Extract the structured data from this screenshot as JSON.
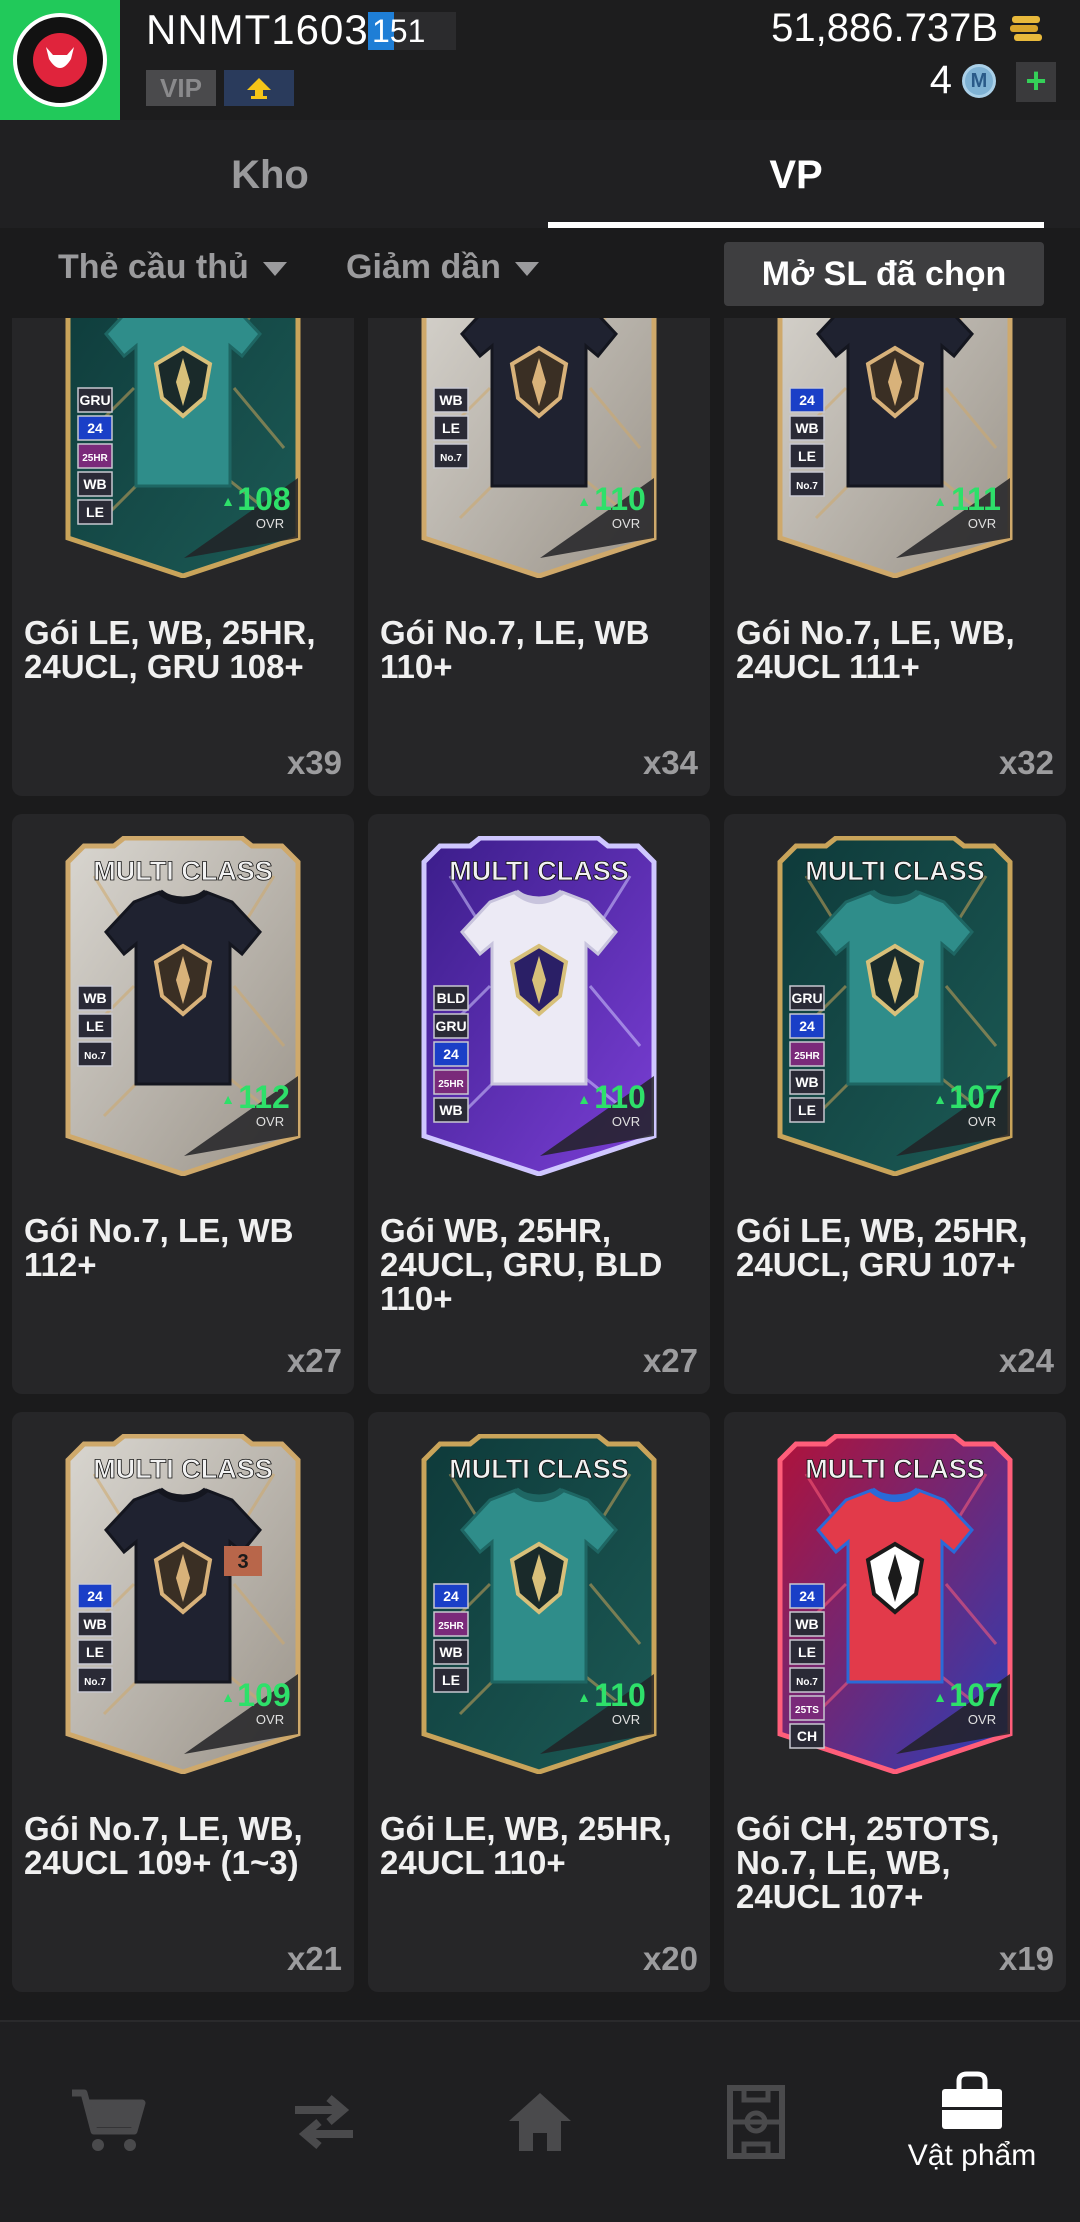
{
  "header": {
    "username": "NNMT1603",
    "level": "151",
    "level_progress": 0.3,
    "vip_label": "VIP",
    "coins": "51,886.737B",
    "m_count": "4",
    "m_icon_text": "M",
    "plus": "+"
  },
  "tabs": [
    {
      "label": "Kho",
      "active": false
    },
    {
      "label": "VP",
      "active": true
    }
  ],
  "filters": {
    "type": "Thẻ cầu thủ",
    "sort": "Giảm dần",
    "open_selected": "Mở SL đã chọn"
  },
  "card_top_label": "MULTI CLASS",
  "ovr_label": "OVR",
  "items": [
    {
      "name": "Gói LE, WB, 25HR, 24UCL, GRU 108+",
      "count": "x39",
      "ovr": "108",
      "style": "teal",
      "tags": [
        "GRU",
        "24",
        "25HR",
        "WB",
        "LE"
      ]
    },
    {
      "name": "Gói No.7, LE, WB 110+",
      "count": "x34",
      "ovr": "110",
      "style": "silver",
      "tags": [
        "WB",
        "LE",
        "No.7"
      ]
    },
    {
      "name": "Gói No.7, LE, WB, 24UCL 111+",
      "count": "x32",
      "ovr": "111",
      "style": "silver",
      "tags": [
        "24",
        "WB",
        "LE",
        "No.7"
      ]
    },
    {
      "name": "Gói No.7, LE, WB 112+",
      "count": "x27",
      "ovr": "112",
      "style": "silver",
      "tags": [
        "WB",
        "LE",
        "No.7"
      ]
    },
    {
      "name": "Gói WB, 25HR, 24UCL, GRU, BLD 110+",
      "count": "x27",
      "ovr": "110",
      "style": "purple",
      "tags": [
        "BLD",
        "GRU",
        "24",
        "25HR",
        "WB"
      ]
    },
    {
      "name": "Gói LE, WB, 25HR, 24UCL, GRU 107+",
      "count": "x24",
      "ovr": "107",
      "style": "teal",
      "tags": [
        "GRU",
        "24",
        "25HR",
        "WB",
        "LE"
      ]
    },
    {
      "name": "Gói No.7, LE, WB, 24UCL 109+ (1~3)",
      "count": "x21",
      "ovr": "109",
      "style": "silver",
      "badge": "3",
      "tags": [
        "24",
        "WB",
        "LE",
        "No.7"
      ]
    },
    {
      "name": "Gói LE, WB, 25HR, 24UCL 110+",
      "count": "x20",
      "ovr": "110",
      "style": "teal",
      "tags": [
        "24",
        "25HR",
        "WB",
        "LE"
      ]
    },
    {
      "name": "Gói CH, 25TOTS, No.7, LE, WB, 24UCL 107+",
      "count": "x19",
      "ovr": "107",
      "style": "red",
      "tags": [
        "24",
        "WB",
        "LE",
        "No.7",
        "25TS",
        "CH"
      ]
    }
  ],
  "nav": [
    {
      "name": "cart-icon",
      "label": ""
    },
    {
      "name": "transfer-icon",
      "label": ""
    },
    {
      "name": "home-icon",
      "label": ""
    },
    {
      "name": "pitch-icon",
      "label": ""
    },
    {
      "name": "bag-icon",
      "label": "Vật phẩm",
      "active": true
    }
  ]
}
